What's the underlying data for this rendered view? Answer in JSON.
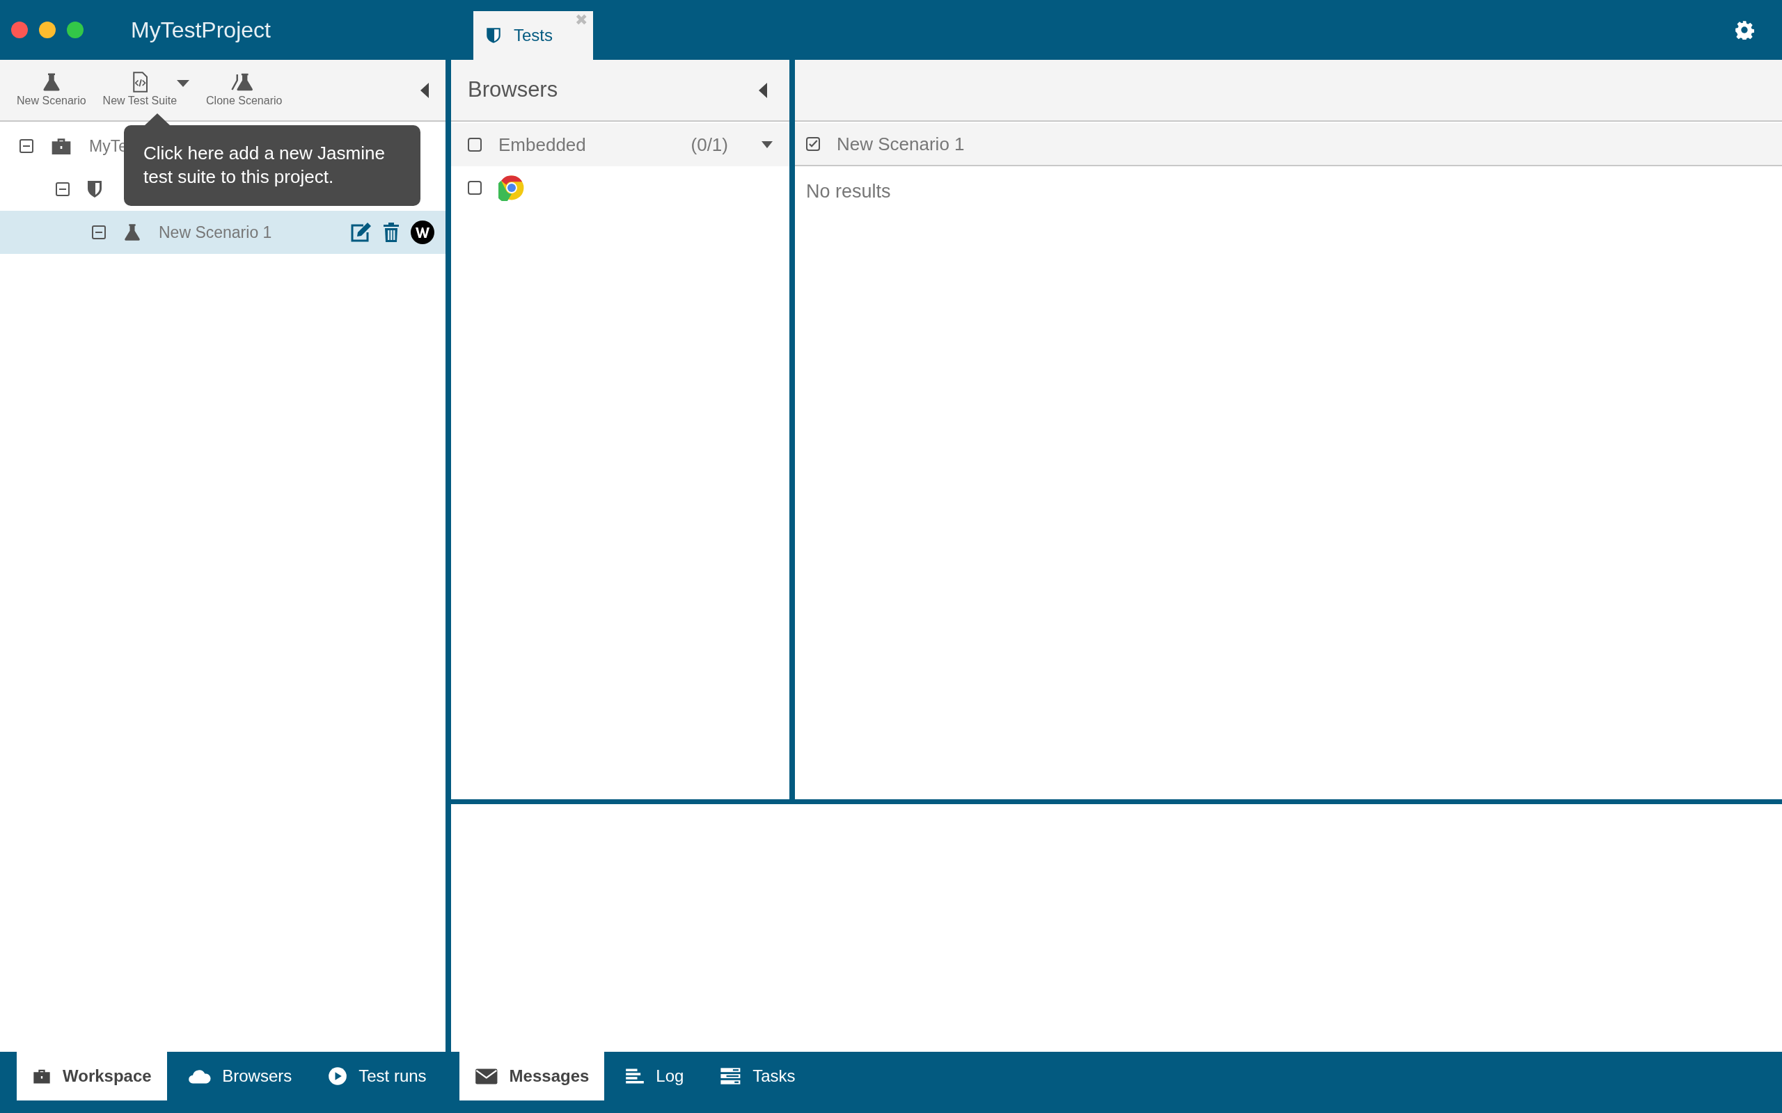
{
  "window": {
    "title": "MyTestProject"
  },
  "tabs": [
    {
      "label": "Tests",
      "selected": true,
      "close": "✖"
    }
  ],
  "toolbar": {
    "buttons": [
      {
        "label": "New Scenario",
        "kind": "flask"
      },
      {
        "label": "New Test Suite",
        "kind": "code-file",
        "dropdown": true
      },
      {
        "label": "Clone Scenario",
        "kind": "flasks"
      }
    ]
  },
  "tree": [
    {
      "label": "MyTe",
      "kind": "project",
      "expanded": true,
      "selected": false,
      "children": [
        {
          "kind": "suite",
          "expanded": true,
          "selected": false,
          "children": [
            {
              "label": "New Scenario 1",
              "kind": "scenario",
              "expanded": true,
              "selected": true
            }
          ]
        }
      ]
    }
  ],
  "tooltip": {
    "text": "Click here add a new Jasmine test suite to this project."
  },
  "browsers": {
    "title": "Browsers",
    "groups": [
      {
        "name": "Embedded",
        "count": "(0/1)",
        "checked": false,
        "expanded": true,
        "items": [
          {
            "kind": "chrome",
            "checked": false
          }
        ]
      }
    ]
  },
  "results": {
    "scenario": {
      "label": "New Scenario 1",
      "checked": true
    },
    "message": "No results"
  },
  "left_tabs": [
    {
      "label": "Workspace",
      "kind": "briefcase",
      "selected": true
    },
    {
      "label": "Browsers",
      "kind": "cloud",
      "selected": false
    },
    {
      "label": "Test runs",
      "kind": "play",
      "selected": false
    }
  ],
  "bottom_tabs": [
    {
      "label": "Messages",
      "kind": "envelope",
      "selected": true
    },
    {
      "label": "Log",
      "kind": "log",
      "selected": false
    },
    {
      "label": "Tasks",
      "kind": "tasks",
      "selected": false
    }
  ]
}
